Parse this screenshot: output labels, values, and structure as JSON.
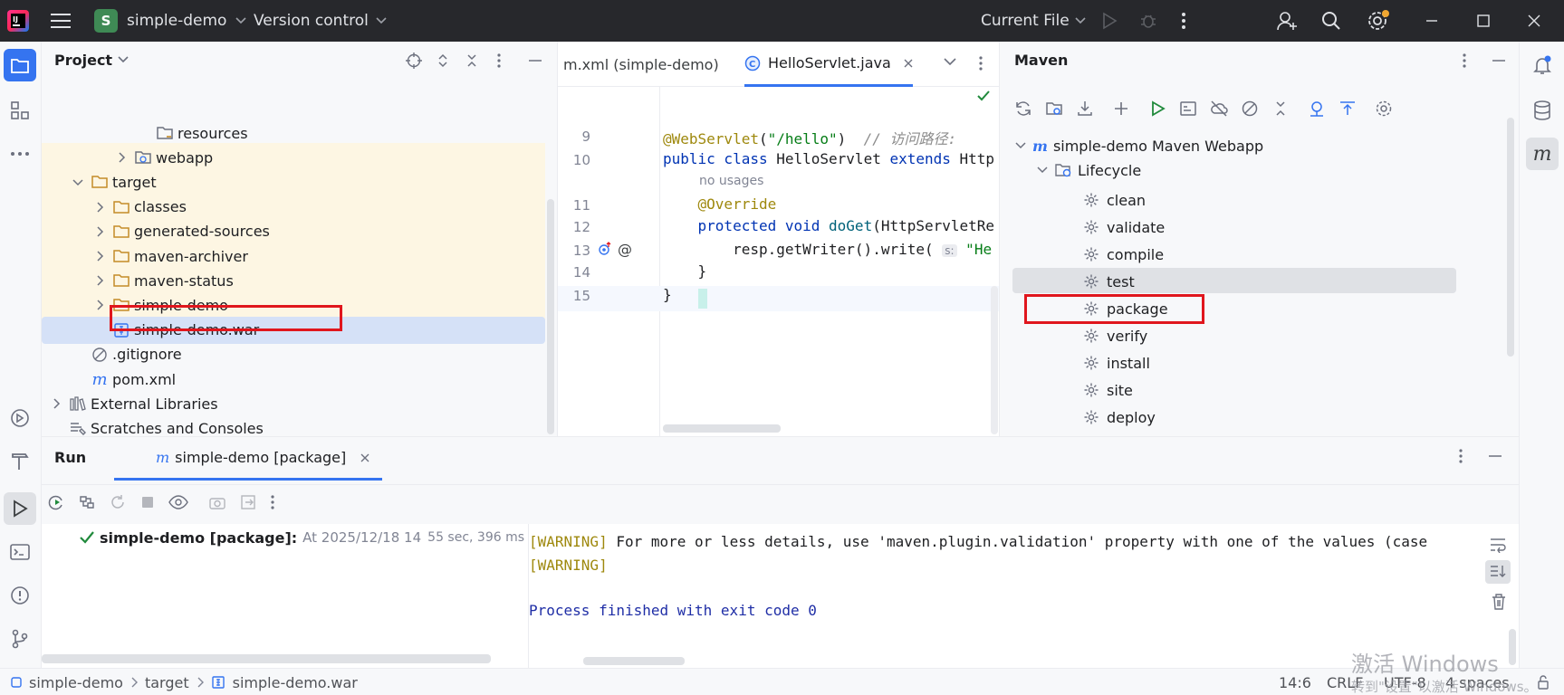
{
  "titlebar": {
    "project_letter": "S",
    "project_name": "simple-demo",
    "vcs_label": "Version control",
    "run_config": "Current File"
  },
  "project_panel": {
    "title": "Project",
    "tree": [
      {
        "label": "resources",
        "indent": 5,
        "chevron": "none",
        "icon": "folder-resources-icon"
      },
      {
        "label": "webapp",
        "indent": 4,
        "chevron": "right",
        "icon": "folder-web-icon"
      },
      {
        "label": "target",
        "indent": 2,
        "chevron": "down",
        "icon": "folder-icon"
      },
      {
        "label": "classes",
        "indent": 3,
        "chevron": "right",
        "icon": "folder-icon"
      },
      {
        "label": "generated-sources",
        "indent": 3,
        "chevron": "right",
        "icon": "folder-icon"
      },
      {
        "label": "maven-archiver",
        "indent": 3,
        "chevron": "right",
        "icon": "folder-icon"
      },
      {
        "label": "maven-status",
        "indent": 3,
        "chevron": "right",
        "icon": "folder-icon"
      },
      {
        "label": "simple-demo",
        "indent": 3,
        "chevron": "right",
        "icon": "folder-icon"
      },
      {
        "label": "simple-demo.war",
        "indent": 3,
        "chevron": "none",
        "icon": "archive-icon"
      },
      {
        "label": ".gitignore",
        "indent": 2,
        "chevron": "none",
        "icon": "ignore-file-icon"
      },
      {
        "label": "pom.xml",
        "indent": 2,
        "chevron": "none",
        "icon": "maven-file-icon"
      },
      {
        "label": "External Libraries",
        "indent": 1,
        "chevron": "right",
        "icon": "library-icon"
      },
      {
        "label": "Scratches and Consoles",
        "indent": 1,
        "chevron": "none",
        "icon": "scratches-icon"
      }
    ]
  },
  "editor": {
    "tabs": [
      {
        "label": "m.xml (simple-demo)",
        "active": false
      },
      {
        "label": "HelloServlet.java",
        "active": true
      }
    ],
    "lines": [
      {
        "num": "9",
        "parts": [
          [
            "ann",
            "@WebServlet"
          ],
          [
            "",
            "("
          ],
          [
            "str",
            "\"/hello\""
          ],
          [
            "",
            ")  "
          ],
          [
            "cm",
            "// 访问路径: "
          ]
        ]
      },
      {
        "num": "10",
        "parts": [
          [
            "kw",
            "public class "
          ],
          [
            "",
            "HelloServlet "
          ],
          [
            "kw",
            "extends "
          ],
          [
            "",
            "Http"
          ]
        ]
      },
      {
        "num": "",
        "hint": "no usages"
      },
      {
        "num": "11",
        "parts": [
          [
            "",
            "    "
          ],
          [
            "ann",
            "@Override"
          ]
        ]
      },
      {
        "num": "12",
        "parts": [
          [
            "",
            "    "
          ],
          [
            "kw",
            "protected void "
          ],
          [
            "fn",
            "doGet"
          ],
          [
            "",
            "(HttpServletRe"
          ]
        ]
      },
      {
        "num": "13",
        "parts": [
          [
            "",
            "        resp.getWriter().write( "
          ],
          [
            "hint",
            "s:"
          ],
          [
            "str",
            " \"He"
          ]
        ]
      },
      {
        "num": "14",
        "parts": [
          [
            "",
            "    }"
          ]
        ]
      },
      {
        "num": "15",
        "parts": [
          [
            "",
            "}"
          ]
        ]
      }
    ]
  },
  "maven_panel": {
    "title": "Maven",
    "project": "simple-demo Maven Webapp",
    "lifecycle_label": "Lifecycle",
    "phases": [
      "clean",
      "validate",
      "compile",
      "test",
      "package",
      "verify",
      "install",
      "site",
      "deploy"
    ],
    "selected_phase": "package"
  },
  "run_panel": {
    "title": "Run",
    "tab_label": "simple-demo [package]",
    "tree_item": "simple-demo [package]:",
    "tree_item_detail": "At 2025/12/18 14",
    "tree_item_time": "55 sec, 396 ms",
    "console": {
      "warn_tag": "[WARNING]",
      "line1_rest": " For more or less details, use 'maven.plugin.validation' property with one of the values (case",
      "line3": "Process finished with exit code 0"
    }
  },
  "statusbar": {
    "breadcrumb": [
      "simple-demo",
      "target",
      "simple-demo.war"
    ],
    "position": "14:6",
    "line_ending": "CRLF",
    "encoding": "UTF-8",
    "indent": "4 spaces",
    "watermark_title": "激活 Windows",
    "watermark_sub": "转到\"设置\"以激活 Windows。"
  },
  "colors": {
    "accent": "#3574f0",
    "run_green": "#208a3c",
    "highlight_red": "#e0161d",
    "warning": "#9e880d"
  }
}
